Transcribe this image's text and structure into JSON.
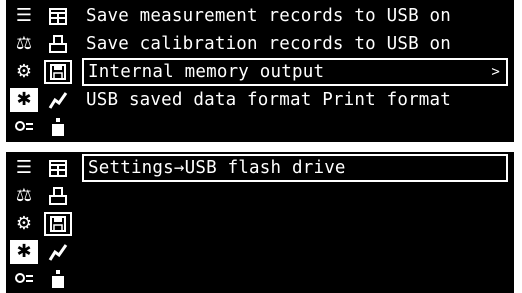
{
  "panel_top": {
    "menu_items": [
      {
        "label": "Save measurement records to USB on"
      },
      {
        "label": "Save calibration records to USB on"
      },
      {
        "label": "Internal memory output",
        "chevron": ">"
      },
      {
        "label": "USB saved data format Print format"
      }
    ],
    "selected_index": 2
  },
  "panel_bottom": {
    "header": "Settings→USB flash drive"
  },
  "icons": {
    "left_column": [
      "list-icon",
      "balance-icon",
      "weight-settings-icon",
      "gear-icon",
      "id-icon"
    ],
    "right_column": [
      "save-records-icon",
      "printer-icon",
      "floppy-disk-icon",
      "graph-icon",
      "calibration-weight-icon"
    ],
    "selected_left": "gear-icon",
    "selected_right": "floppy-disk-icon"
  }
}
